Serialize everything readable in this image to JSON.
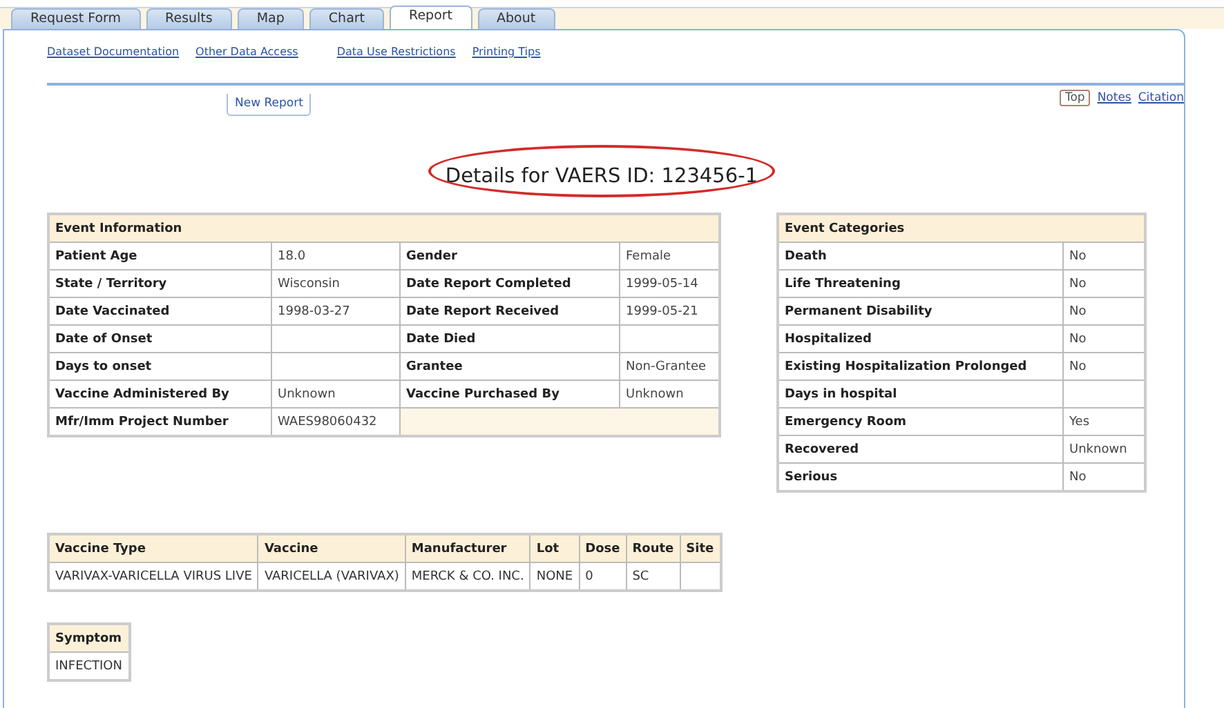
{
  "tabs": [
    {
      "label": "Request Form",
      "selected": false
    },
    {
      "label": "Results",
      "selected": false
    },
    {
      "label": "Map",
      "selected": false
    },
    {
      "label": "Chart",
      "selected": false
    },
    {
      "label": "Report",
      "selected": true
    },
    {
      "label": "About",
      "selected": false
    }
  ],
  "links": [
    "Dataset Documentation",
    "Other Data Access",
    "Data Use Restrictions",
    "Printing Tips"
  ],
  "new_report_button": "New Report",
  "page_nav": [
    {
      "label": "Top",
      "selected": true
    },
    {
      "label": "Notes",
      "selected": false
    },
    {
      "label": "Citation",
      "selected": false
    }
  ],
  "title": {
    "text": "Details for VAERS ID: 123456-1",
    "circled": true
  },
  "event_information": {
    "title": "Event Information",
    "rows": [
      {
        "label": "Patient Age",
        "value": "18.0",
        "label_2": "Gender",
        "value_2": "Female"
      },
      {
        "label": "State / Territory",
        "value": "Wisconsin",
        "label_2": "Date Report Completed",
        "value_2": "1999-05-14"
      },
      {
        "label": "Date Vaccinated",
        "value": "1998-03-27",
        "label_2": "Date Report Received",
        "value_2": "1999-05-21"
      },
      {
        "label": "Date of Onset",
        "label_2": "Date Died"
      },
      {
        "label": "Days to onset",
        "label_2": "Grantee",
        "value_2": "Non-Grantee"
      },
      {
        "label": "Vaccine Administered By",
        "value": "Unknown",
        "label_2": "Vaccine Purchased By",
        "value_2": "Unknown"
      },
      {
        "label": "Mfr/Imm Project Number",
        "value": "WAES98060432"
      }
    ]
  },
  "event_categories": {
    "title": "Event Categories",
    "rows": [
      {
        "label": "Death",
        "value": "No"
      },
      {
        "label": "Life Threatening",
        "value": "No"
      },
      {
        "label": "Permanent Disability",
        "value": "No"
      },
      {
        "label": "Hospitalized",
        "value": "No"
      },
      {
        "label": "Existing Hospitalization Prolonged",
        "value": "No"
      },
      {
        "label": "Days in hospital"
      },
      {
        "label": "Emergency Room",
        "value": "Yes"
      },
      {
        "label": "Recovered",
        "value": "Unknown"
      },
      {
        "label": "Serious",
        "value": "No"
      }
    ]
  },
  "vaccines": {
    "columns": [
      "Vaccine Type",
      "Vaccine",
      "Manufacturer",
      "Lot",
      "Dose",
      "Route",
      "Site"
    ],
    "rows": [
      [
        "VARIVAX-VARICELLA VIRUS LIVE",
        "VARICELLA (VARIVAX)",
        "MERCK & CO. INC.",
        "NONE",
        "0",
        "SC",
        null
      ]
    ]
  },
  "symptoms": {
    "columns": [
      "Symptom"
    ],
    "rows": [
      [
        "INFECTION"
      ]
    ]
  }
}
